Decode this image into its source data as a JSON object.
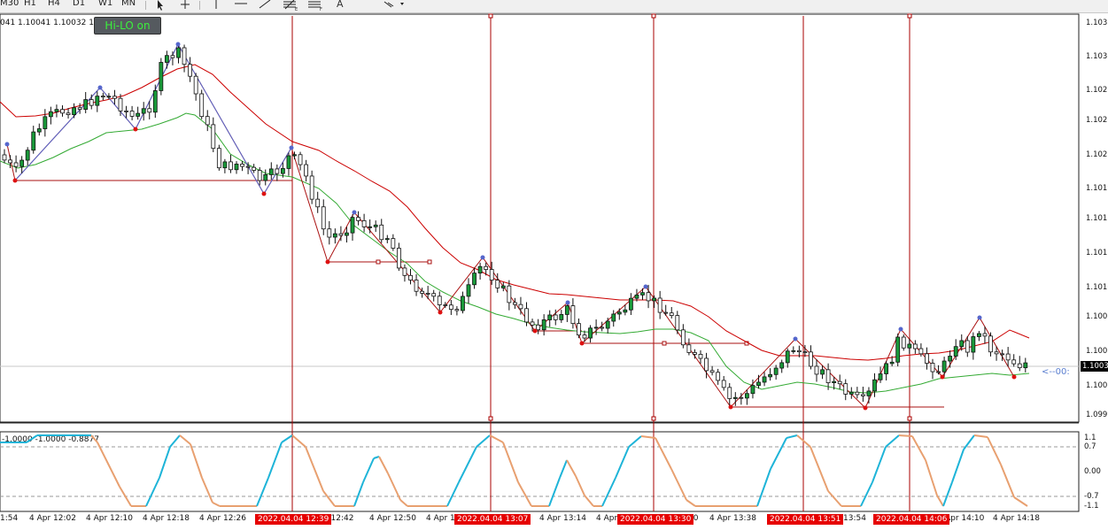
{
  "toolbar": {
    "timeframes": [
      "M30",
      "H1",
      "H4",
      "D1",
      "W1",
      "MN"
    ],
    "tools": [
      "cursor-icon",
      "crosshair-icon",
      "vertical-line-icon",
      "horizontal-line-icon",
      "trendline-icon",
      "fibonacci-icon",
      "fibo-channel-icon",
      "text-icon",
      "shapes-dropdown-icon"
    ],
    "text_tool_label": "A"
  },
  "chart": {
    "ohlc_text": "041 1.10041 1.10032 1.10",
    "hilo_button": "Hi-LO on",
    "price_labels": [
      "1.1033",
      "1.1030",
      "1.1027",
      "1.1025",
      "1.1022",
      "1.1019",
      "1.1016",
      "1.1013",
      "1.1010",
      "1.1008",
      "1.1005",
      "1.1002",
      "1.0999"
    ],
    "current_price": "1.1003",
    "shift_marker": "<--00:",
    "colors": {
      "bull_candle": "#1a9a3a",
      "bear_candle": "#ffffff",
      "upper_band": "#cc0000",
      "middle_ma": "#33aa33",
      "zigzag": "#aa1111",
      "high_dot": "#5566cc",
      "low_dot": "#dd1111",
      "vertical_marker": "#aa0000",
      "osc_rising": "#1eb4d8",
      "osc_falling": "#e8a070"
    }
  },
  "indicator": {
    "header": "-1.0000 -1.0000 -0.8877",
    "levels": [
      "1.1",
      "0.7",
      "0.00",
      "-0.7",
      "-1.1"
    ]
  },
  "time_axis": {
    "labels": [
      "1:54",
      "4 Apr 12:02",
      "4 Apr 12:10",
      "4 Apr 12:18",
      "4 Apr 12:26",
      "r 12:42",
      "4 Apr 12:50",
      "4 Apr 1",
      "4 Apr 13:14",
      "4 Apr",
      "30",
      "4 Apr 13:38",
      "13:54",
      "Apr 14:10",
      "4 Apr 14:18"
    ],
    "markers": [
      "2022.04.04 12:39",
      "2022.04.04 13:07",
      "2022.04.04 13:30",
      "2022.04.04 13:51",
      "2022.04.04 14:06"
    ]
  }
}
